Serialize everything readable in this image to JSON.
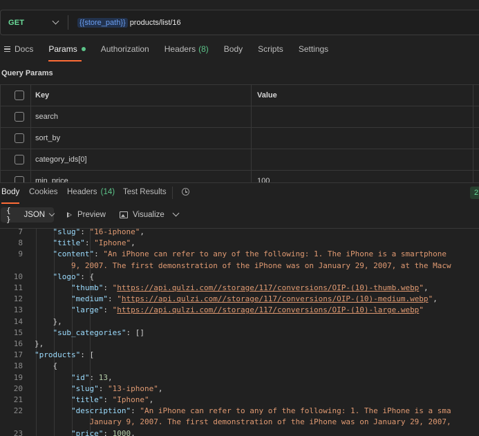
{
  "request": {
    "method": "GET",
    "url_variable": "{{store_path}}",
    "url_path": "products/list/16"
  },
  "request_tabs": [
    {
      "label": "Docs"
    },
    {
      "label": "Params"
    },
    {
      "label": "Authorization"
    },
    {
      "label": "Headers",
      "count": "(8)"
    },
    {
      "label": "Body"
    },
    {
      "label": "Scripts"
    },
    {
      "label": "Settings"
    }
  ],
  "params": {
    "title": "Query Params",
    "key_header": "Key",
    "value_header": "Value",
    "rows": [
      {
        "key": "search",
        "value": ""
      },
      {
        "key": "sort_by",
        "value": ""
      },
      {
        "key": "category_ids[0]",
        "value": ""
      },
      {
        "key": "min_price",
        "value": "100"
      }
    ]
  },
  "response_tabs": [
    {
      "label": "Body"
    },
    {
      "label": "Cookies"
    },
    {
      "label": "Headers",
      "count": "(14)"
    },
    {
      "label": "Test Results"
    }
  ],
  "status_partial": "2",
  "toolbar": {
    "format": "JSON",
    "preview": "Preview",
    "visualize": "Visualize"
  },
  "code_lines": [
    {
      "n": "7",
      "t": "            <k>\"slug\"</k>: <s>\"16-iphone\"</s>,"
    },
    {
      "n": "8",
      "t": "            <k>\"title\"</k>: <s>\"Iphone\"</s>,"
    },
    {
      "n": "9",
      "t": "            <k>\"content\"</k>: <s>\"An iPhone can refer to any of the following: 1. The iPhone is a smartphone</s>"
    },
    {
      "n": "",
      "t": "                <s>9, 2007. The first demonstration of the iPhone was on January 29, 2007, at the Macw</s>"
    },
    {
      "n": "10",
      "t": "            <k>\"logo\"</k>: {"
    },
    {
      "n": "11",
      "t": "                <k>\"thumb\"</k>: <s>\"</s><u>https://api.qulzi.com//storage/117/conversions/OIP-(10)-thumb.webp</u><s>\"</s>,"
    },
    {
      "n": "12",
      "t": "                <k>\"medium\"</k>: <s>\"</s><u>https://api.qulzi.com//storage/117/conversions/OIP-(10)-medium.webp</u><s>\"</s>,"
    },
    {
      "n": "13",
      "t": "                <k>\"large\"</k>: <s>\"</s><u>https://api.qulzi.com//storage/117/conversions/OIP-(10)-large.webp</u><s>\"</s>"
    },
    {
      "n": "14",
      "t": "            },"
    },
    {
      "n": "15",
      "t": "            <k>\"sub_categories\"</k>: []"
    },
    {
      "n": "16",
      "t": "        },"
    },
    {
      "n": "17",
      "t": "        <k>\"products\"</k>: ["
    },
    {
      "n": "18",
      "t": "            {"
    },
    {
      "n": "19",
      "t": "                <k>\"id\"</k>: <n>13</n>,"
    },
    {
      "n": "20",
      "t": "                <k>\"slug\"</k>: <s>\"13-iphone\"</s>,"
    },
    {
      "n": "21",
      "t": "                <k>\"title\"</k>: <s>\"Iphone\"</s>,"
    },
    {
      "n": "22",
      "t": "                <k>\"description\"</k>: <s>\"An iPhone can refer to any of the following: 1. The iPhone is a sma</s>"
    },
    {
      "n": "",
      "t": "                    <s>January 9, 2007. The first demonstration of the iPhone was on January 29, 2007,</s>"
    },
    {
      "n": "23",
      "t": "                <k>\"price\"</k>: <n>1000</n>,"
    }
  ]
}
